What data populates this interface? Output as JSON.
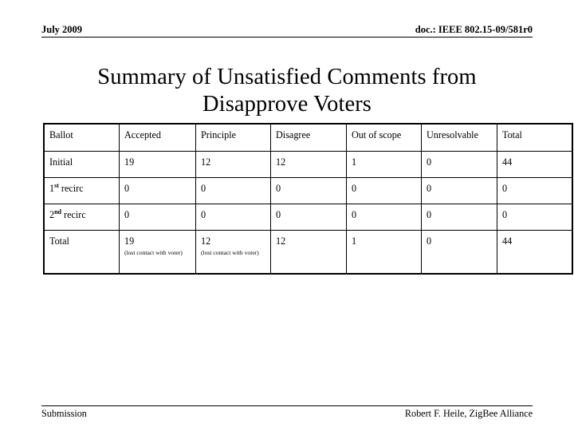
{
  "header": {
    "left": "July 2009",
    "right": "doc.: IEEE 802.15-09/581r0"
  },
  "title": "Summary of Unsatisfied Comments from Disapprove Voters",
  "table": {
    "columns": [
      "Ballot",
      "Accepted",
      "Principle",
      "Disagree",
      "Out of scope",
      "Unresolvable",
      "Total"
    ],
    "rows": [
      {
        "ballot": "Initial",
        "ballot_sup": "",
        "ballot_rest": "",
        "accepted": "19",
        "accepted_note": "",
        "principle": "12",
        "principle_note": "",
        "disagree": "12",
        "out_of_scope": "1",
        "unresolvable": "0",
        "total": "44"
      },
      {
        "ballot": "1",
        "ballot_sup": "st",
        "ballot_rest": " recirc",
        "accepted": "0",
        "accepted_note": "",
        "principle": "0",
        "principle_note": "",
        "disagree": "0",
        "out_of_scope": "0",
        "unresolvable": "0",
        "total": "0"
      },
      {
        "ballot": "2",
        "ballot_sup": "nd",
        "ballot_rest": " recirc",
        "accepted": "0",
        "accepted_note": "",
        "principle": "0",
        "principle_note": "",
        "disagree": "0",
        "out_of_scope": "0",
        "unresolvable": "0",
        "total": "0"
      },
      {
        "ballot": "Total",
        "ballot_sup": "",
        "ballot_rest": "",
        "accepted": "19",
        "accepted_note": "(lost contact with voter)",
        "principle": "12",
        "principle_note": "(lost contact with voter)",
        "disagree": "12",
        "out_of_scope": "1",
        "unresolvable": "0",
        "total": "44"
      }
    ]
  },
  "footer": {
    "left": "Submission",
    "right": "Robert F. Heile, ZigBee Alliance"
  },
  "colors": {
    "text": "#000000",
    "background": "#ffffff",
    "border": "#000000"
  }
}
